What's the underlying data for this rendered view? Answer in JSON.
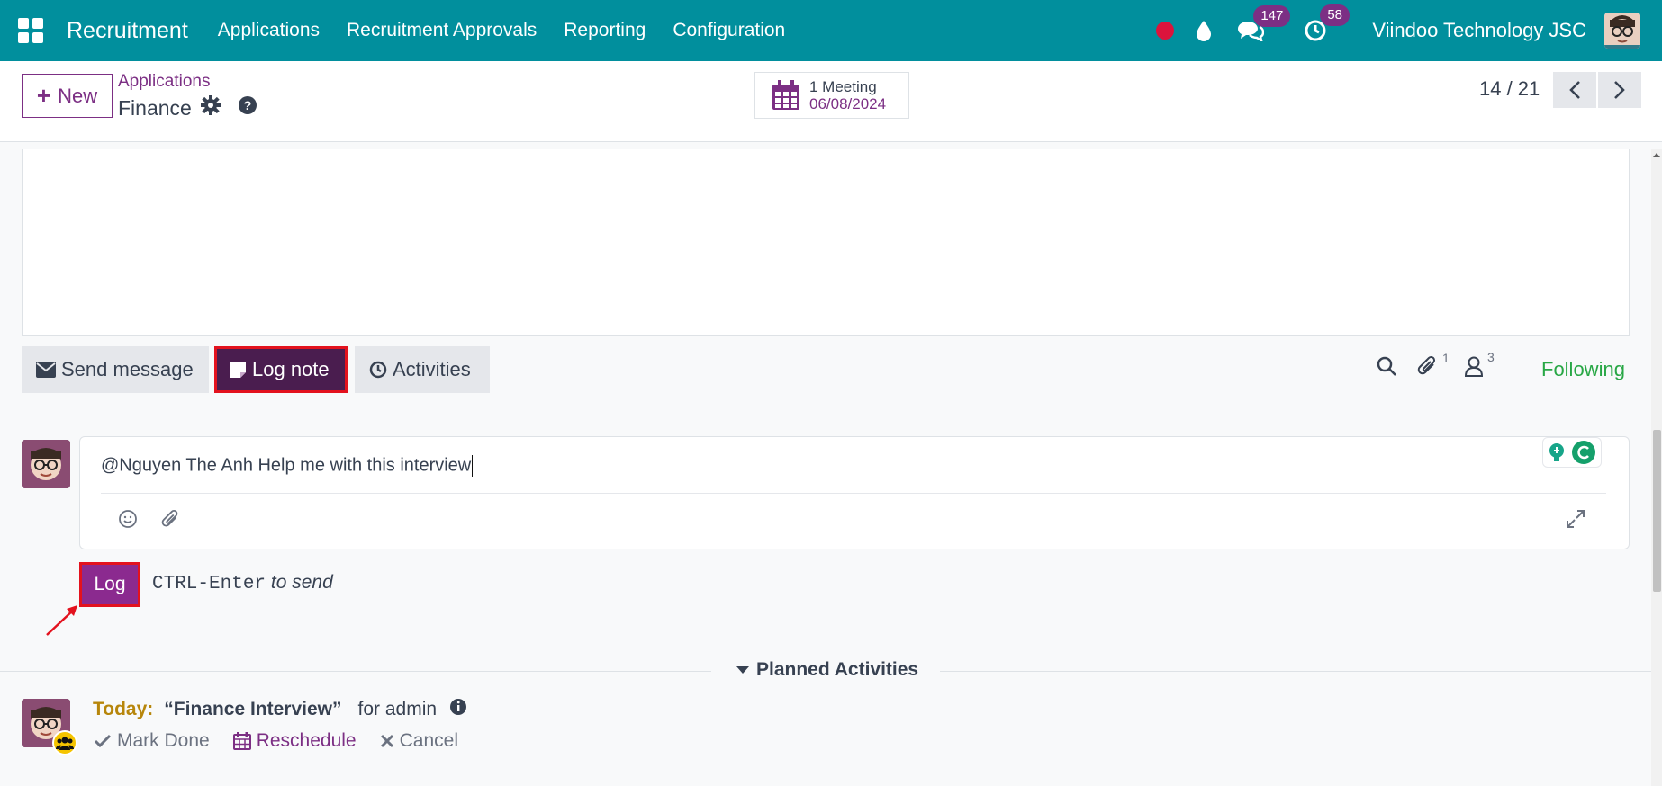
{
  "navbar": {
    "app_name": "Recruitment",
    "menu": [
      "Applications",
      "Recruitment Approvals",
      "Reporting",
      "Configuration"
    ],
    "messages_count": "147",
    "activities_count": "58",
    "company": "Viindoo Technology JSC",
    "colors": {
      "bar": "#018f9d",
      "badge": "#7c2f84",
      "record": "#dc143c"
    }
  },
  "control": {
    "new_label": "New",
    "breadcrumb_parent": "Applications",
    "breadcrumb_current": "Finance",
    "meeting_label": "1 Meeting",
    "meeting_date": "06/08/2024",
    "pager": "14 / 21"
  },
  "chatter": {
    "send_message": "Send message",
    "log_note": "Log note",
    "activities": "Activities",
    "attachments_count": "1",
    "followers_count": "3",
    "following": "Following",
    "composer_text": "@Nguyen The Anh Help me with this interview",
    "log_button": "Log",
    "hint_key": "CTRL-Enter",
    "hint_text": "to send"
  },
  "planned": {
    "title": "Planned Activities",
    "today_label": "Today:",
    "summary": "“Finance Interview”",
    "for_text": "for admin",
    "mark_done": "Mark Done",
    "reschedule": "Reschedule",
    "cancel": "Cancel"
  },
  "icons": {
    "apps": "apps-grid-icon",
    "record": "record-dot-icon",
    "water": "water-drop-icon",
    "chat": "chat-icon",
    "clock": "clock-icon",
    "gear": "gear-icon",
    "help": "question-circle-icon",
    "calendar": "calendar-icon",
    "search": "search-icon",
    "paperclip": "paperclip-icon",
    "user": "user-icon",
    "emoji": "emoji-icon",
    "expand": "expand-icon"
  }
}
